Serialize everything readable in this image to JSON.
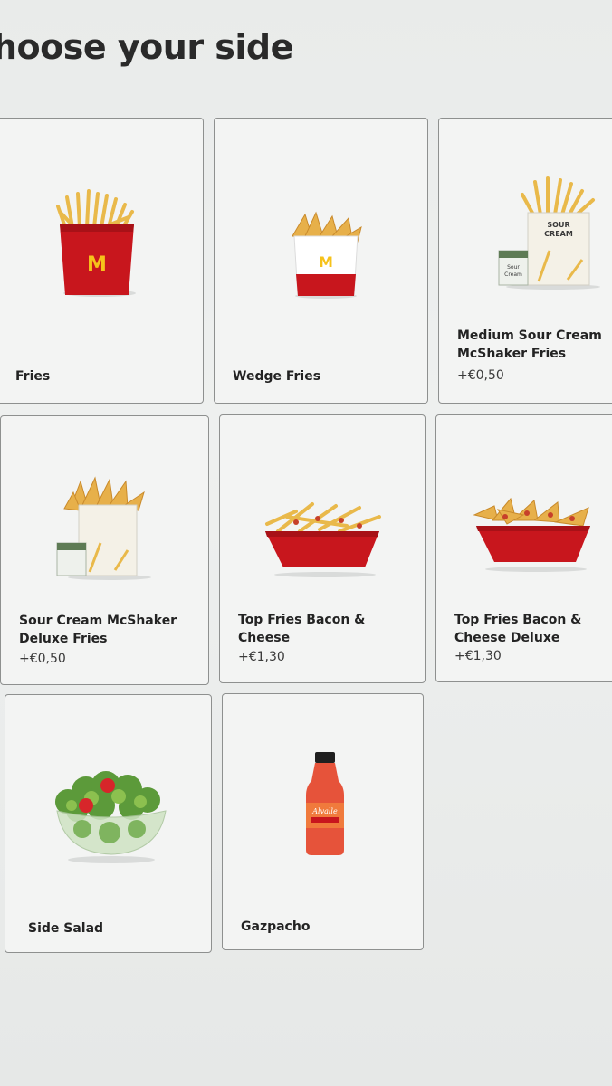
{
  "page": {
    "title": "hoose your side"
  },
  "items": [
    {
      "name": "Fries",
      "price": ""
    },
    {
      "name": "Wedge Fries",
      "price": ""
    },
    {
      "name": "Medium Sour Cream McShaker Fries",
      "price": "+€0,50"
    },
    {
      "name": "Sour Cream McShaker Deluxe Fries",
      "price": "+€0,50"
    },
    {
      "name": "Top Fries Bacon & Cheese",
      "price": "+€1,30"
    },
    {
      "name": "Top Fries Bacon & Cheese Deluxe",
      "price": "+€1,30"
    },
    {
      "name": "Side Salad",
      "price": ""
    },
    {
      "name": "Gazpacho",
      "price": ""
    }
  ],
  "product_art": {
    "sour_cream_box_lines": [
      "SOUR",
      "CREAM"
    ],
    "shaker_sachet_lines": [
      "Sour",
      "Cream"
    ],
    "gazpacho_label": "Alvalle"
  },
  "colors": {
    "mcdonalds_red": "#c8161d",
    "golden_arches": "#f6c21a",
    "fries_yellow": "#f1c55a",
    "card_border": "#8e908f"
  }
}
